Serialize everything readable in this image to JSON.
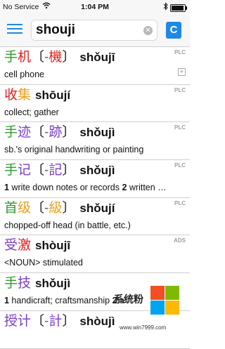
{
  "status": {
    "carrier": "No Service",
    "time": "1:04 PM",
    "battery_level": 0.85
  },
  "search": {
    "value": "shouji"
  },
  "c_button": {
    "label": "C"
  },
  "colors": {
    "accent": "#1e88e5",
    "tone1": "#e02020",
    "tone2": "#e8a020",
    "tone3": "#2d9a2d",
    "tone4": "#7a3fc4"
  },
  "entries": [
    {
      "hanzi": [
        {
          "c": "手",
          "t": 3
        },
        {
          "c": "机",
          "t": 1
        }
      ],
      "trad": [
        {
          "c": "-",
          "t": 5
        },
        {
          "c": "機",
          "t": 1
        }
      ],
      "pinyin": [
        {
          "s": "shǒu",
          "t": 3
        },
        {
          "s": "jī",
          "t": 1
        }
      ],
      "tag": "PLC",
      "definition": "cell phone",
      "has_plus": true
    },
    {
      "hanzi": [
        {
          "c": "收",
          "t": 1
        },
        {
          "c": "集",
          "t": 2
        }
      ],
      "trad": [],
      "pinyin": [
        {
          "s": "shōu",
          "t": 1
        },
        {
          "s": "jí",
          "t": 2
        }
      ],
      "tag": "PLC",
      "definition": "collect; gather",
      "has_plus": false
    },
    {
      "hanzi": [
        {
          "c": "手",
          "t": 3
        },
        {
          "c": "迹",
          "t": 4
        }
      ],
      "trad": [
        {
          "c": "-",
          "t": 5
        },
        {
          "c": "跡",
          "t": 4
        }
      ],
      "pinyin": [
        {
          "s": "shǒu",
          "t": 3
        },
        {
          "s": "jì",
          "t": 4
        }
      ],
      "tag": "PLC",
      "definition": "sb.'s original handwriting or painting",
      "has_plus": false
    },
    {
      "hanzi": [
        {
          "c": "手",
          "t": 3
        },
        {
          "c": "记",
          "t": 4
        }
      ],
      "trad": [
        {
          "c": "-",
          "t": 5
        },
        {
          "c": "記",
          "t": 4
        }
      ],
      "pinyin": [
        {
          "s": "shǒu",
          "t": 3
        },
        {
          "s": "jì",
          "t": 4
        }
      ],
      "tag": "PLC",
      "definition": "1 write down notes or records  2 written …",
      "has_plus": false
    },
    {
      "hanzi": [
        {
          "c": "首",
          "t": 3
        },
        {
          "c": "级",
          "t": 2
        }
      ],
      "trad": [
        {
          "c": "-",
          "t": 5
        },
        {
          "c": "級",
          "t": 2
        }
      ],
      "pinyin": [
        {
          "s": "shǒu",
          "t": 3
        },
        {
          "s": "jí",
          "t": 2
        }
      ],
      "tag": "PLC",
      "definition": "chopped-off head (in battle, etc.)",
      "has_plus": false
    },
    {
      "hanzi": [
        {
          "c": "受",
          "t": 4
        },
        {
          "c": "激",
          "t": 1
        }
      ],
      "trad": [],
      "pinyin": [
        {
          "s": "shòu",
          "t": 4
        },
        {
          "s": "jī",
          "t": 1
        }
      ],
      "tag": "ADS",
      "definition": "<NOUN> stimulated",
      "has_plus": false
    },
    {
      "hanzi": [
        {
          "c": "手",
          "t": 3
        },
        {
          "c": "技",
          "t": 4
        }
      ],
      "trad": [],
      "pinyin": [
        {
          "s": "shǒu",
          "t": 3
        },
        {
          "s": "jì",
          "t": 4
        }
      ],
      "tag": "",
      "definition": "1 handicraft; craftsmanship  2 a",
      "has_plus": false
    },
    {
      "hanzi": [
        {
          "c": "授",
          "t": 4
        },
        {
          "c": "计",
          "t": 4
        }
      ],
      "trad": [
        {
          "c": "-",
          "t": 5
        },
        {
          "c": "計",
          "t": 4
        }
      ],
      "pinyin": [
        {
          "s": "shòu",
          "t": 4
        },
        {
          "s": "jì",
          "t": 4
        }
      ],
      "tag": "",
      "definition": "",
      "has_plus": false
    }
  ],
  "watermark": {
    "name": "系统粉",
    "url": "www.win7999.com",
    "logo_colors": [
      "#f25022",
      "#7fba00",
      "#00a4ef",
      "#ffb900"
    ]
  }
}
